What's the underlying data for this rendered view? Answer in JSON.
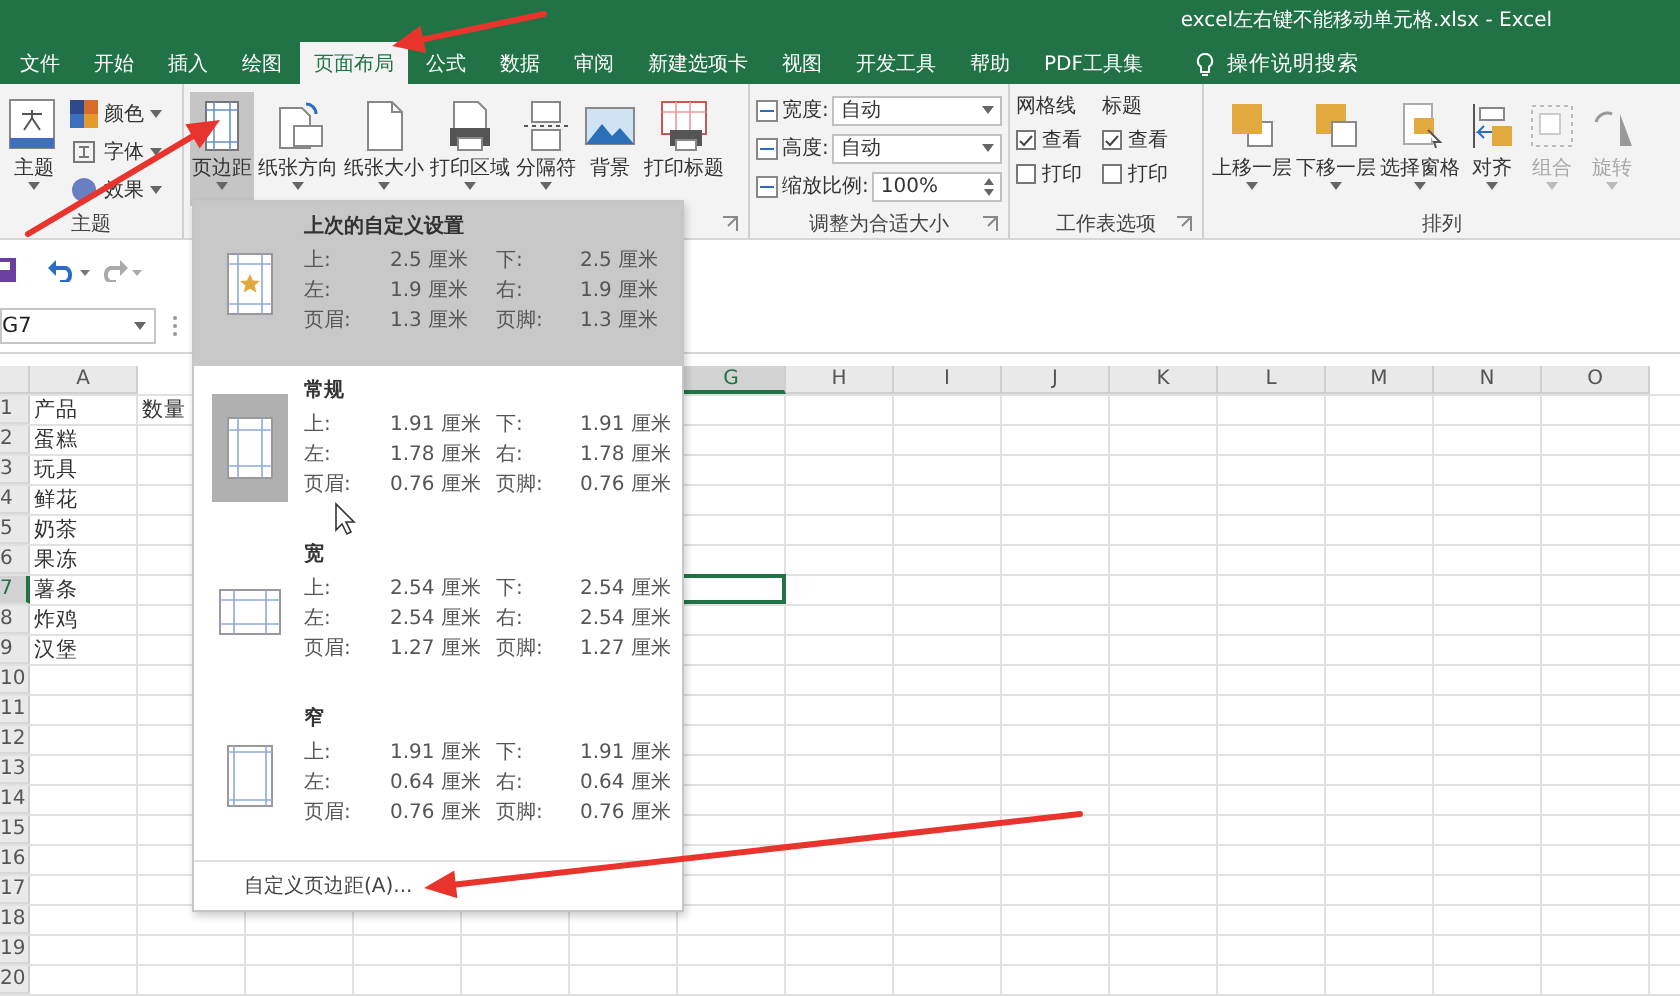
{
  "window": {
    "title": "excel左右键不能移动单元格.xlsx  -  Excel"
  },
  "tabs": [
    {
      "label": "文件",
      "selected": false
    },
    {
      "label": "开始",
      "selected": false
    },
    {
      "label": "插入",
      "selected": false
    },
    {
      "label": "绘图",
      "selected": false
    },
    {
      "label": "页面布局",
      "selected": true
    },
    {
      "label": "公式",
      "selected": false
    },
    {
      "label": "数据",
      "selected": false
    },
    {
      "label": "审阅",
      "selected": false
    },
    {
      "label": "新建选项卡",
      "selected": false
    },
    {
      "label": "视图",
      "selected": false
    },
    {
      "label": "开发工具",
      "selected": false
    },
    {
      "label": "帮助",
      "selected": false
    },
    {
      "label": "PDF工具集",
      "selected": false
    }
  ],
  "search": {
    "label": "操作说明搜索"
  },
  "ribbon": {
    "theme_group": {
      "label": "主题",
      "button": "主题",
      "items": [
        {
          "label": "颜色",
          "kind": "colors"
        },
        {
          "label": "字体",
          "kind": "fonts"
        },
        {
          "label": "效果",
          "kind": "effects"
        }
      ]
    },
    "page_setup": {
      "buttons": [
        {
          "label": "页边距",
          "selected": true,
          "kind": "margins"
        },
        {
          "label": "纸张方向",
          "selected": false,
          "kind": "orientation"
        },
        {
          "label": "纸张大小",
          "selected": false,
          "kind": "size"
        },
        {
          "label": "打印区域",
          "selected": false,
          "kind": "print_area"
        },
        {
          "label": "分隔符",
          "selected": false,
          "kind": "breaks"
        },
        {
          "label": "背景",
          "selected": false,
          "kind": "background"
        },
        {
          "label": "打印标题",
          "selected": false,
          "kind": "print_titles"
        }
      ]
    },
    "scale_group": {
      "label": "调整为合适大小",
      "fields": [
        {
          "label": "宽度:",
          "value": "自动",
          "kind": "dropdown"
        },
        {
          "label": "高度:",
          "value": "自动",
          "kind": "dropdown"
        },
        {
          "label": "缩放比例:",
          "value": "100%",
          "kind": "spinner"
        }
      ]
    },
    "sheet_options": {
      "label": "工作表选项",
      "columns": [
        {
          "title": "网格线",
          "options": [
            {
              "label": "查看",
              "checked": true
            },
            {
              "label": "打印",
              "checked": false
            }
          ]
        },
        {
          "title": "标题",
          "options": [
            {
              "label": "查看",
              "checked": true
            },
            {
              "label": "打印",
              "checked": false
            }
          ]
        }
      ]
    },
    "arrange": {
      "label": "排列",
      "buttons": [
        {
          "label": "上移一层",
          "disabled": false,
          "kind": "bring_forward"
        },
        {
          "label": "下移一层",
          "disabled": false,
          "kind": "send_backward"
        },
        {
          "label": "选择窗格",
          "disabled": false,
          "kind": "selection_pane"
        },
        {
          "label": "对齐",
          "disabled": false,
          "kind": "align"
        },
        {
          "label": "组合",
          "disabled": true,
          "kind": "group"
        },
        {
          "label": "旋转",
          "disabled": true,
          "kind": "rotate"
        }
      ]
    }
  },
  "name_box": {
    "value": "G7"
  },
  "sheet": {
    "columns": [
      {
        "letter": "A",
        "selected": false
      },
      {
        "letter": "G",
        "selected": true
      },
      {
        "letter": "H",
        "selected": false
      },
      {
        "letter": "I",
        "selected": false
      },
      {
        "letter": "J",
        "selected": false
      },
      {
        "letter": "K",
        "selected": false
      },
      {
        "letter": "L",
        "selected": false
      },
      {
        "letter": "M",
        "selected": false
      },
      {
        "letter": "N",
        "selected": false
      },
      {
        "letter": "O",
        "selected": false
      }
    ],
    "rows": [
      {
        "number": "1",
        "selected": false,
        "cells": [
          "产品",
          "数量"
        ]
      },
      {
        "number": "2",
        "selected": false,
        "cells": [
          "蛋糕"
        ]
      },
      {
        "number": "3",
        "selected": false,
        "cells": [
          "玩具"
        ]
      },
      {
        "number": "4",
        "selected": false,
        "cells": [
          "鲜花"
        ]
      },
      {
        "number": "5",
        "selected": false,
        "cells": [
          "奶茶"
        ]
      },
      {
        "number": "6",
        "selected": false,
        "cells": [
          "果冻"
        ]
      },
      {
        "number": "7",
        "selected": true,
        "cells": [
          "薯条"
        ]
      },
      {
        "number": "8",
        "selected": false,
        "cells": [
          "炸鸡"
        ]
      },
      {
        "number": "9",
        "selected": false,
        "cells": [
          "汉堡"
        ]
      },
      {
        "number": "10",
        "selected": false,
        "cells": []
      },
      {
        "number": "11",
        "selected": false,
        "cells": []
      },
      {
        "number": "12",
        "selected": false,
        "cells": []
      },
      {
        "number": "13",
        "selected": false,
        "cells": []
      },
      {
        "number": "14",
        "selected": false,
        "cells": []
      },
      {
        "number": "15",
        "selected": false,
        "cells": []
      },
      {
        "number": "16",
        "selected": false,
        "cells": []
      },
      {
        "number": "17",
        "selected": false,
        "cells": []
      },
      {
        "number": "18",
        "selected": false,
        "cells": []
      },
      {
        "number": "19",
        "selected": false,
        "cells": []
      },
      {
        "number": "20",
        "selected": false,
        "cells": []
      }
    ]
  },
  "margins_menu": {
    "items": [
      {
        "title": "上次的自定义设置",
        "kind": "custom",
        "selected": true,
        "current": false,
        "rows": [
          {
            "label_1": "上:",
            "value_1": "2.5 厘米",
            "label_2": "下:",
            "value_2": "2.5 厘米"
          },
          {
            "label_1": "左:",
            "value_1": "1.9 厘米",
            "label_2": "右:",
            "value_2": "1.9 厘米"
          },
          {
            "label_1": "页眉:",
            "value_1": "1.3 厘米",
            "label_2": "页脚:",
            "value_2": "1.3 厘米"
          }
        ]
      },
      {
        "title": "常规",
        "kind": "normal",
        "selected": false,
        "current": true,
        "rows": [
          {
            "label_1": "上:",
            "value_1": "1.91 厘米",
            "label_2": "下:",
            "value_2": "1.91 厘米"
          },
          {
            "label_1": "左:",
            "value_1": "1.78 厘米",
            "label_2": "右:",
            "value_2": "1.78 厘米"
          },
          {
            "label_1": "页眉:",
            "value_1": "0.76 厘米",
            "label_2": "页脚:",
            "value_2": "0.76 厘米"
          }
        ]
      },
      {
        "title": "宽",
        "kind": "wide",
        "selected": false,
        "current": false,
        "rows": [
          {
            "label_1": "上:",
            "value_1": "2.54 厘米",
            "label_2": "下:",
            "value_2": "2.54 厘米"
          },
          {
            "label_1": "左:",
            "value_1": "2.54 厘米",
            "label_2": "右:",
            "value_2": "2.54 厘米"
          },
          {
            "label_1": "页眉:",
            "value_1": "1.27 厘米",
            "label_2": "页脚:",
            "value_2": "1.27 厘米"
          }
        ]
      },
      {
        "title": "窄",
        "kind": "narrow",
        "selected": false,
        "current": false,
        "rows": [
          {
            "label_1": "上:",
            "value_1": "1.91 厘米",
            "label_2": "下:",
            "value_2": "1.91 厘米"
          },
          {
            "label_1": "左:",
            "value_1": "0.64 厘米",
            "label_2": "右:",
            "value_2": "0.64 厘米"
          },
          {
            "label_1": "页眉:",
            "value_1": "0.76 厘米",
            "label_2": "页脚:",
            "value_2": "0.76 厘米"
          }
        ]
      }
    ],
    "footer": "自定义页边距(A)..."
  }
}
